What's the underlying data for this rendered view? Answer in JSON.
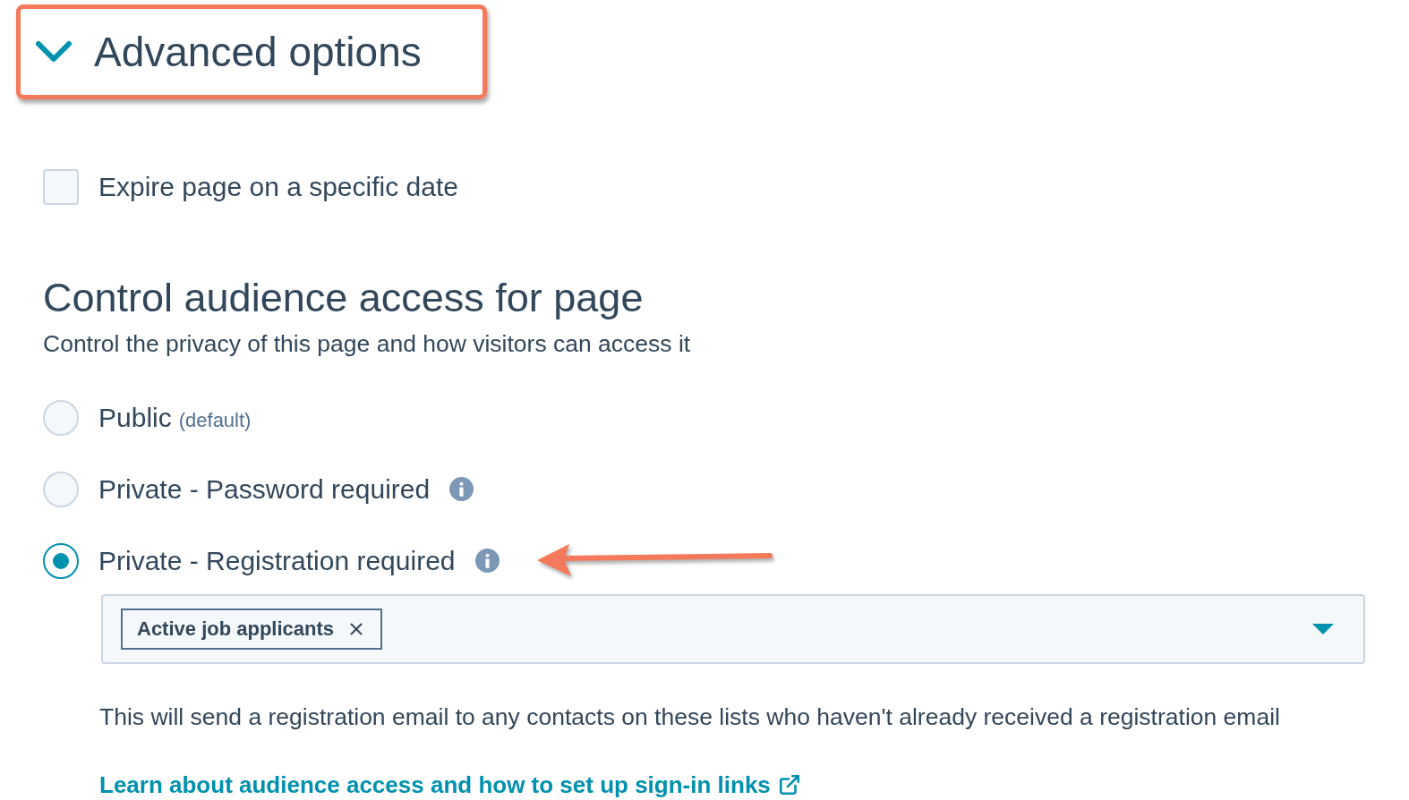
{
  "section": {
    "title": "Advanced options",
    "expanded": true,
    "highlighted": true
  },
  "expire_option": {
    "label": "Expire page on a specific date",
    "checked": false
  },
  "access": {
    "heading": "Control audience access for page",
    "description": "Control the privacy of this page and how visitors can access it",
    "options": [
      {
        "label": "Public",
        "note": "(default)",
        "info": false,
        "selected": false,
        "annotated": false
      },
      {
        "label": "Private - Password required",
        "info": true,
        "selected": false,
        "annotated": false
      },
      {
        "label": "Private - Registration required",
        "info": true,
        "selected": true,
        "annotated": true
      }
    ]
  },
  "lists_field": {
    "tags": [
      "Active job applicants"
    ],
    "hint": "This will send a registration email to any contacts on these lists who haven't already received a registration email",
    "link": "Learn about audience access and how to set up sign-in links"
  }
}
